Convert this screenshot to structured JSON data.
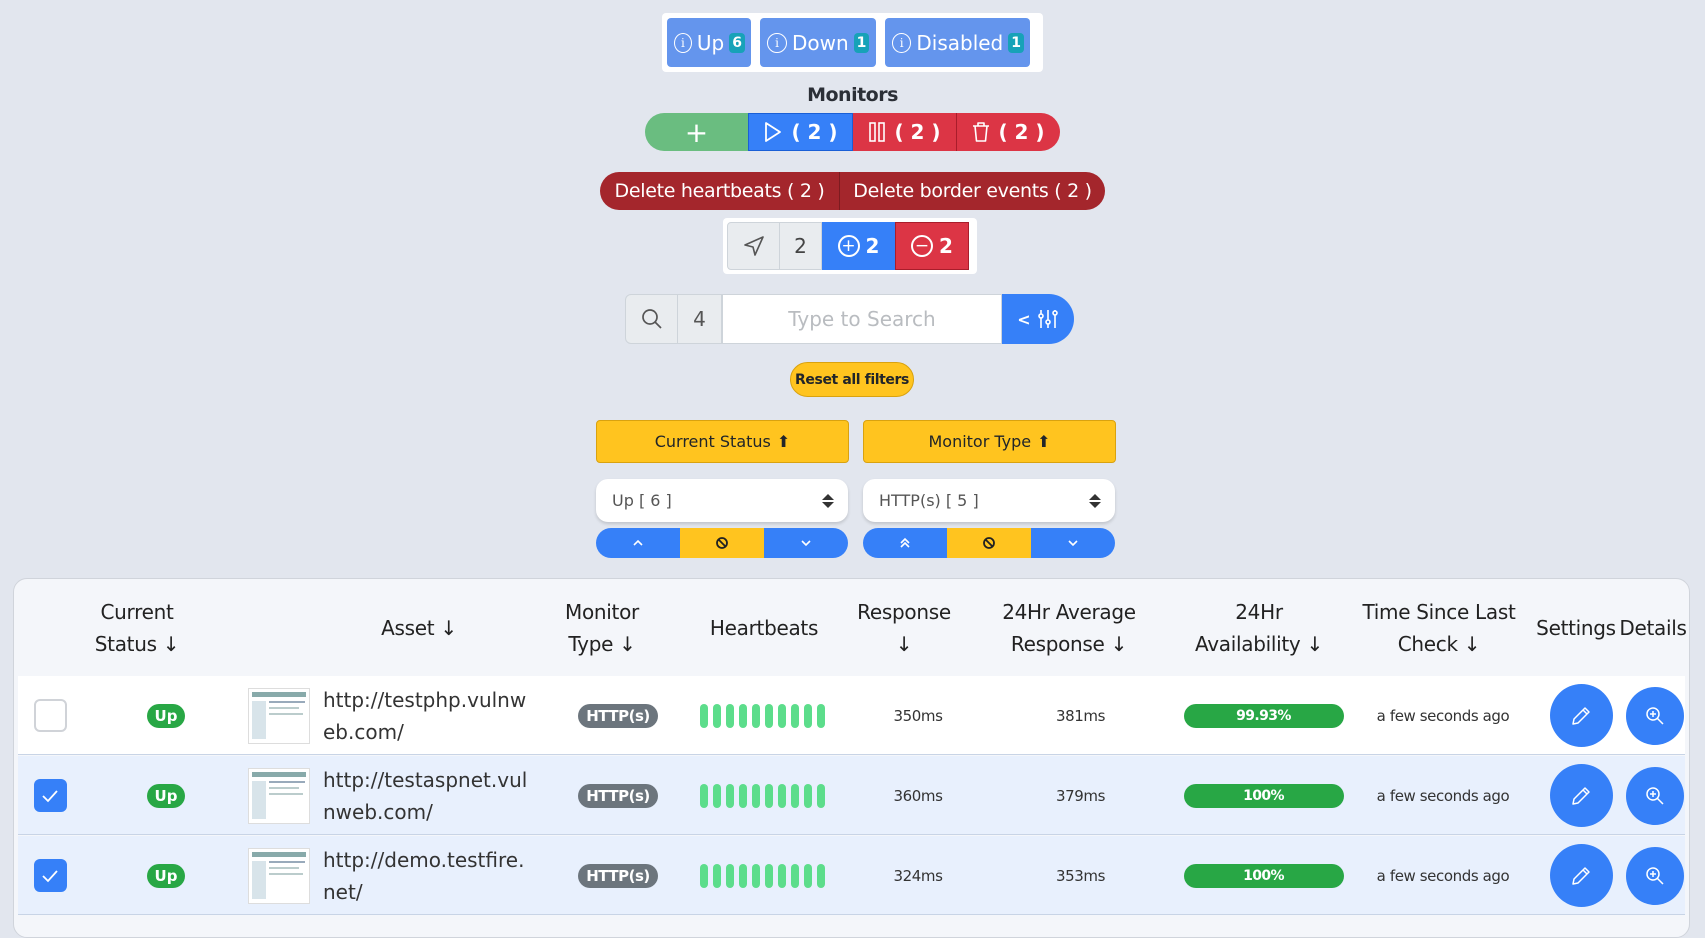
{
  "status_summary": [
    {
      "label": "Up",
      "count": "6",
      "icon": "info-circle-icon"
    },
    {
      "label": "Down",
      "count": "1",
      "icon": "info-circle-icon"
    },
    {
      "label": "Disabled",
      "count": "1",
      "icon": "info-circle-icon"
    }
  ],
  "monitors": {
    "title": "Monitors",
    "add_label": "+",
    "resume_label": "( 2 )",
    "pause_label": "( 2 )",
    "delete_label": "( 2 )"
  },
  "delete_bar": {
    "heartbeats_label": "Delete heartbeats ( 2 )",
    "border_events_label": "Delete border events ( 2 )"
  },
  "selection": {
    "selected_count": "2",
    "select_all_count": "2",
    "deselect_count": "2"
  },
  "search": {
    "result_count": "4",
    "placeholder": "Type to Search",
    "value": "",
    "toggle_label": "<"
  },
  "reset_filters_label": "Reset all filters",
  "filters": [
    {
      "header": "Current Status",
      "header_icon": "⬆",
      "selected": "Up [ 6 ]"
    },
    {
      "header": "Monitor Type",
      "header_icon": "⬆",
      "selected": "HTTP(s) [ 5 ]"
    }
  ],
  "table": {
    "columns": [
      {
        "line1": "Current",
        "line2": "Status ↓"
      },
      {
        "line1": "Asset ↓",
        "line2": ""
      },
      {
        "line1": "Monitor",
        "line2": "Type ↓"
      },
      {
        "line1": "Heartbeats",
        "line2": ""
      },
      {
        "line1": "Response",
        "line2": "↓"
      },
      {
        "line1": "24Hr Average",
        "line2": "Response ↓"
      },
      {
        "line1": "24Hr",
        "line2": "Availability ↓"
      },
      {
        "line1": "Time Since Last",
        "line2": "Check ↓"
      },
      {
        "line1": "Settings",
        "line2": ""
      },
      {
        "line1": "Details",
        "line2": ""
      }
    ],
    "rows": [
      {
        "checked": false,
        "status": "Up",
        "asset": "http://testphp.vulnweb.com/",
        "type": "HTTP(s)",
        "heartbeats": 10,
        "response": "350ms",
        "avg_response": "381ms",
        "availability": "99.93%",
        "last_check": "a few seconds ago"
      },
      {
        "checked": true,
        "status": "Up",
        "asset": "http://testaspnet.vulnweb.com/",
        "type": "HTTP(s)",
        "heartbeats": 10,
        "response": "360ms",
        "avg_response": "379ms",
        "availability": "100%",
        "last_check": "a few seconds ago"
      },
      {
        "checked": true,
        "status": "Up",
        "asset": "http://demo.testfire.net/",
        "type": "HTTP(s)",
        "heartbeats": 10,
        "response": "324ms",
        "avg_response": "353ms",
        "availability": "100%",
        "last_check": "a few seconds ago"
      }
    ]
  },
  "colors": {
    "primary": "#3680f8",
    "danger": "#dc3545",
    "dark_danger": "#a4262c",
    "success": "#28a745",
    "heartbeat": "#5cdd8b",
    "warning": "#ffc41f",
    "status_button": "#6495ed",
    "info_badge": "#17a2b8"
  }
}
